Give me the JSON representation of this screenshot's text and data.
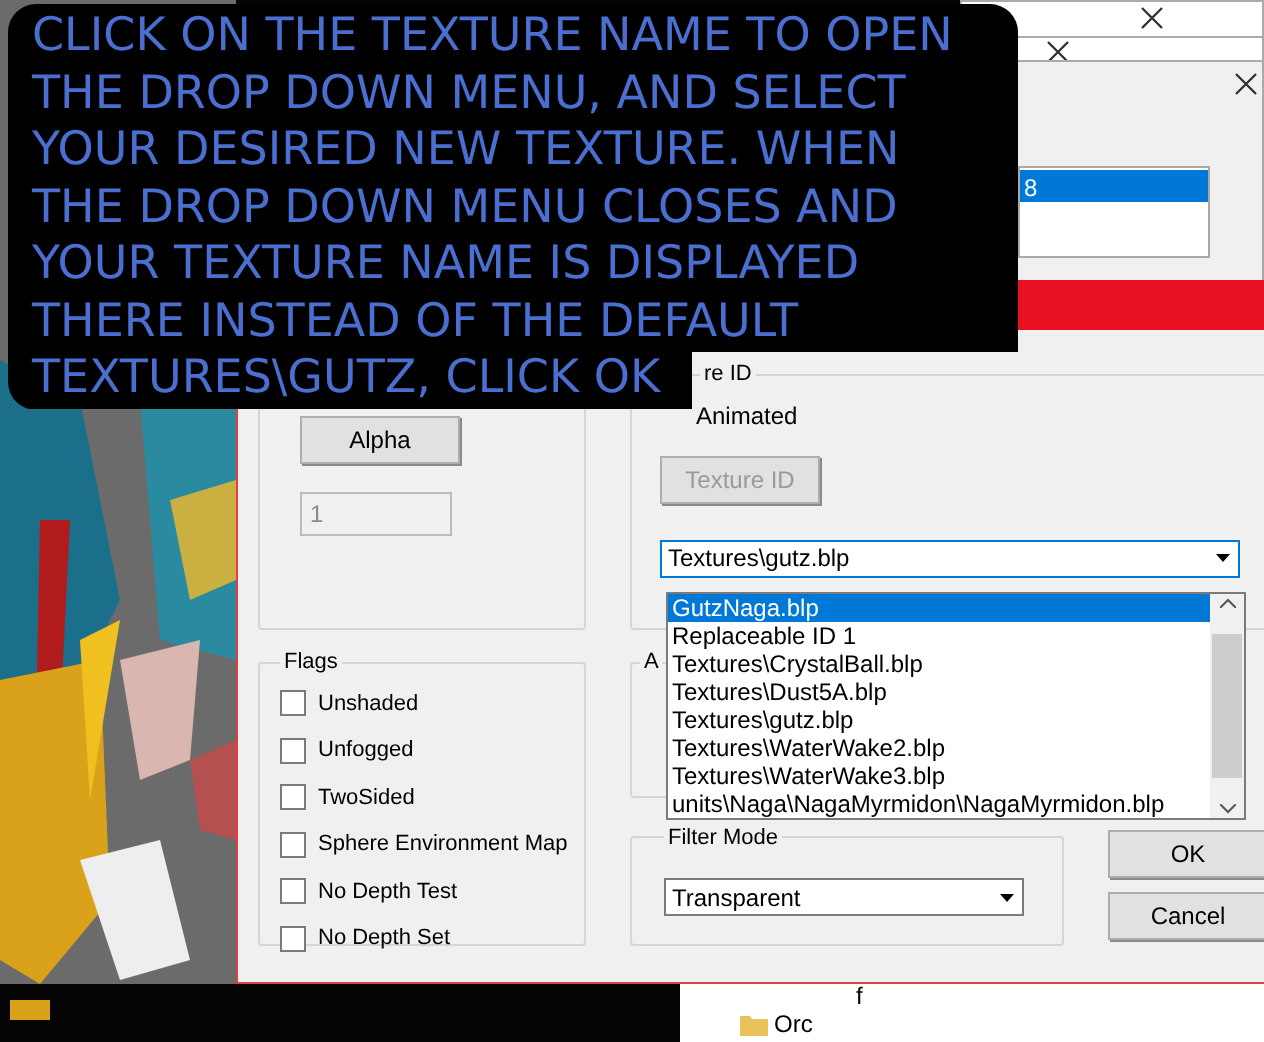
{
  "caption": "CLICK ON THE TEXTURE NAME TO OPEN THE DROP DOWN MENU, AND SELECT YOUR DESIRED NEW TEXTURE. WHEN THE DROP DOWN MENU CLOSES AND YOUR TEXTURE NAME IS DISPLAYED THERE INSTEAD OF THE DEFAULT TEXTURES\\GUTZ, CLICK OK",
  "window_list": {
    "rows": [
      {
        "label": "8",
        "selected": true
      }
    ]
  },
  "dialog": {
    "alpha_group": {
      "button": "Alpha",
      "field": {
        "value": "1",
        "disabled": true
      }
    },
    "texture_group": {
      "legend": "re ID",
      "animated": {
        "label": "Animated"
      },
      "button": {
        "label": "Texture ID",
        "disabled": true
      },
      "combo": {
        "value": "Textures\\gutz.blp",
        "expanded": true
      },
      "options": [
        {
          "label": "GutzNaga.blp",
          "selected": true
        },
        {
          "label": "Replaceable ID 1",
          "selected": false
        },
        {
          "label": "Textures\\CrystalBall.blp",
          "selected": false
        },
        {
          "label": "Textures\\Dust5A.blp",
          "selected": false
        },
        {
          "label": "Textures\\gutz.blp",
          "selected": false
        },
        {
          "label": "Textures\\WaterWake2.blp",
          "selected": false
        },
        {
          "label": "Textures\\WaterWake3.blp",
          "selected": false
        },
        {
          "label": "units\\Naga\\NagaMyrmidon\\NagaMyrmidon.blp",
          "selected": false
        }
      ]
    },
    "flags": {
      "legend": "Flags",
      "items": [
        {
          "label": "Unshaded",
          "checked": false
        },
        {
          "label": "Unfogged",
          "checked": false
        },
        {
          "label": "TwoSided",
          "checked": false
        },
        {
          "label": "Sphere Environment Map",
          "checked": false
        },
        {
          "label": "No Depth Test",
          "checked": false
        },
        {
          "label": "No Depth Set",
          "checked": false
        }
      ]
    },
    "animation_group": {
      "legend": "A"
    },
    "filter_mode": {
      "legend": "Filter Mode",
      "value": "Transparent"
    },
    "buttons": [
      "OK",
      "Cancel"
    ]
  },
  "tree": {
    "items": [
      {
        "label": "f"
      },
      {
        "label": "Orc"
      }
    ]
  }
}
